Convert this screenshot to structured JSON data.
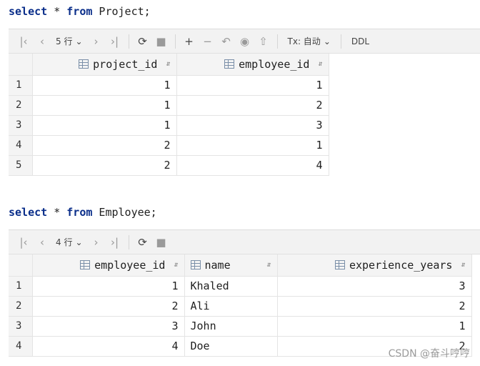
{
  "query1": {
    "keyword_select": "select",
    "star": " * ",
    "keyword_from": "from",
    "rest": " Project;"
  },
  "toolbar1": {
    "rows_label": "5 行",
    "tx_label": "Tx: 自动",
    "ddl_label": "DDL"
  },
  "table1": {
    "headers": [
      "project_id",
      "employee_id"
    ],
    "rows": [
      {
        "n": "1",
        "c": [
          "1",
          "1"
        ]
      },
      {
        "n": "2",
        "c": [
          "1",
          "2"
        ]
      },
      {
        "n": "3",
        "c": [
          "1",
          "3"
        ]
      },
      {
        "n": "4",
        "c": [
          "2",
          "1"
        ]
      },
      {
        "n": "5",
        "c": [
          "2",
          "4"
        ]
      }
    ]
  },
  "query2": {
    "keyword_select": "select",
    "star": " * ",
    "keyword_from": "from",
    "rest": " Employee;"
  },
  "toolbar2": {
    "rows_label": "4 行"
  },
  "table2": {
    "headers": [
      "employee_id",
      "name",
      "experience_years"
    ],
    "rows": [
      {
        "n": "1",
        "c": [
          "1",
          "Khaled",
          "3"
        ]
      },
      {
        "n": "2",
        "c": [
          "2",
          "Ali",
          "2"
        ]
      },
      {
        "n": "3",
        "c": [
          "3",
          "John",
          "1"
        ]
      },
      {
        "n": "4",
        "c": [
          "4",
          "Doe",
          "2"
        ]
      }
    ]
  },
  "watermark": "CSDN @奋斗哼哼",
  "icons": {
    "first": "first-page-icon",
    "prev": "prev-page-icon",
    "next": "next-page-icon",
    "last": "last-page-icon",
    "refresh": "refresh-icon",
    "stop": "stop-icon",
    "add": "add-row-icon",
    "remove": "remove-row-icon",
    "revert": "revert-icon",
    "preview": "preview-icon",
    "submit": "submit-icon"
  },
  "colors": {
    "keyword": "#0a2e8a",
    "header_bg": "#f4f4f4",
    "toolbar_bg": "#f2f2f2"
  }
}
